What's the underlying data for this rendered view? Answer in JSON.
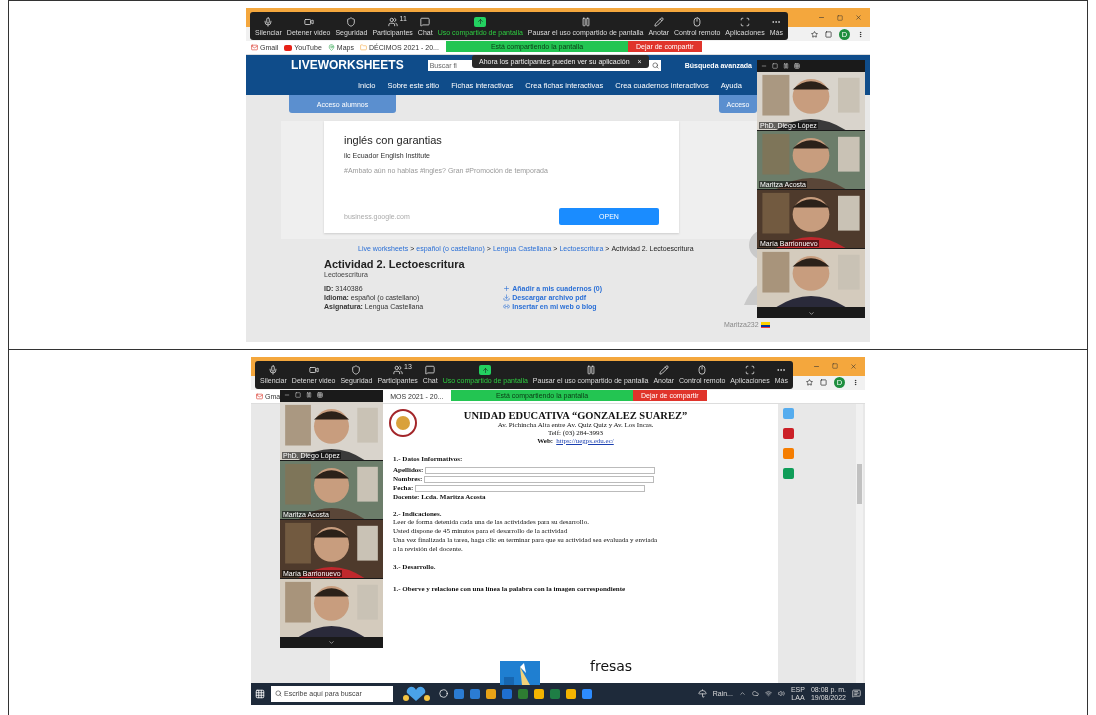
{
  "screenshots": [
    {
      "kind": "liveworksheets",
      "zoom_toolbar": {
        "buttons": [
          {
            "label": "Silenciar",
            "highlighted": false
          },
          {
            "label": "Detener video",
            "highlighted": false
          },
          {
            "label": "Seguridad",
            "highlighted": false
          },
          {
            "label": "Participantes",
            "highlighted": false,
            "count": "11"
          },
          {
            "label": "Chat",
            "highlighted": false
          },
          {
            "label": "Uso compartido de pantalla",
            "highlighted": true
          },
          {
            "label": "Pausar el uso compartido de pantalla",
            "highlighted": false
          },
          {
            "label": "Anotar",
            "highlighted": false
          },
          {
            "label": "Control remoto",
            "highlighted": false
          },
          {
            "label": "Aplicaciones",
            "highlighted": false
          },
          {
            "label": "Más",
            "highlighted": false
          }
        ],
        "sharing": "Está compartiendo la pantalla",
        "stop": "Dejar de compartir"
      },
      "profile_initial": "D",
      "bookmarks": [
        {
          "kind": "gmail",
          "label": "Gmail"
        },
        {
          "kind": "youtube",
          "label": "YouTube"
        },
        {
          "kind": "maps",
          "label": "Maps"
        },
        {
          "kind": "folder",
          "label": "DÉCIMOS 2021 - 20..."
        }
      ],
      "site": {
        "logo": "LIVEWORKSHEETS",
        "search_value": "Buscar fi",
        "advanced": "Búsqueda avanzada",
        "notification": "Ahora los participantes pueden ver su aplicación",
        "notification_close": "×",
        "nav": [
          "Inicio",
          "Sobre este sitio",
          "Fichas interactivas",
          "Crea fichas interactivas",
          "Crea cuadernos interactivos",
          "Ayuda"
        ],
        "access_tabs": [
          "Acceso alumnos",
          "Acceso"
        ],
        "ad": {
          "title": "inglés con garantias",
          "advertiser": "ilc Ecuador English Institute",
          "tags": "#Ambato aún no hablas #ingles? Gran #Promoción de temporada",
          "domain": "business.google.com",
          "button": "OPEN"
        },
        "breadcrumb": [
          {
            "label": "Live worksheets",
            "link": true
          },
          {
            "label": ">",
            "link": false
          },
          {
            "label": "español (o castellano)",
            "link": true
          },
          {
            "label": ">",
            "link": false
          },
          {
            "label": "Lengua Castellana",
            "link": true
          },
          {
            "label": ">",
            "link": false
          },
          {
            "label": "Lectoescritura",
            "link": true
          },
          {
            "label": ">",
            "link": false
          },
          {
            "label": "Actividad 2. Lectoescritura",
            "link": false
          }
        ],
        "title": "Actividad 2. Lectoescritura",
        "subtitle": "Lectoescritura",
        "meta": [
          {
            "label": "ID:",
            "value": "3140386"
          },
          {
            "label": "Idioma:",
            "value": "español (o castellano)"
          },
          {
            "label": "Asignatura:",
            "value": "Lengua Castellana"
          }
        ],
        "actions": [
          "Añadir a mis cuadernos (0)",
          "Descargar archivo pdf",
          "Insertar en mi web o blog"
        ],
        "author": "Maritza232"
      },
      "video_panel": {
        "tiles": [
          {
            "kind": "video",
            "name": "PhD. Diego López"
          },
          {
            "kind": "video",
            "name": "Maritza Acosta"
          },
          {
            "kind": "video",
            "name": "María Barrionuevo"
          },
          {
            "kind": "video"
          }
        ]
      }
    },
    {
      "kind": "document",
      "zoom_toolbar": {
        "buttons": [
          {
            "label": "Silenciar",
            "highlighted": false
          },
          {
            "label": "Detener video",
            "highlighted": false
          },
          {
            "label": "Seguridad",
            "highlighted": false
          },
          {
            "label": "Participantes",
            "highlighted": false,
            "count": "13"
          },
          {
            "label": "Chat",
            "highlighted": false
          },
          {
            "label": "Uso compartido de pantalla",
            "highlighted": true
          },
          {
            "label": "Pausar el uso compartido de pantalla",
            "highlighted": false
          },
          {
            "label": "Anotar",
            "highlighted": false
          },
          {
            "label": "Control remoto",
            "highlighted": false
          },
          {
            "label": "Aplicaciones",
            "highlighted": false
          },
          {
            "label": "Más",
            "highlighted": false
          }
        ],
        "sharing": "Está compartiendo la pantalla",
        "stop": "Dejar de compartir"
      },
      "profile_initial": "D",
      "bookmarks": [
        {
          "kind": "gmail",
          "label": "Gma"
        },
        {
          "kind": "plain",
          "label": "MOS 2021 - 20..."
        }
      ],
      "document": {
        "school": "UNIDAD EDUCATIVA “GONZALEZ SUAREZ”",
        "address": "Av. Pichincha Alta entre Av. Quiz Quiz y Av. Los Incas.",
        "phone": "Telf: (03) 284-3993",
        "web_label": "Web:",
        "web_link": "https://uegps.edu.ec/",
        "section_1": "1.- Datos Informativos:",
        "fields": [
          {
            "label": "Apellidos:"
          },
          {
            "label": "Nombres:"
          },
          {
            "label": "Fecha:"
          }
        ],
        "teacher": "Docente: Lcda. Maritza Acosta",
        "section_2": "2.- Indicaciones.",
        "instructions": [
          "Leer de forma detenida cada una de las actividades para su desarrollo.",
          "Usted dispone de 45 minutos para el desarrollo de la actividad",
          "Una vez finalizada la tarea, haga clic en terminar para que su actividad sea evaluada y enviada",
          "a la revisión del docente."
        ],
        "section_3": "3.- Desarrollo.",
        "exercise": "1.- Oberve y relacione con una línea la palabra con la imagen correspondiente",
        "word": "fresas"
      },
      "video_panel": {
        "tiles": [
          {
            "kind": "video",
            "name": "PhD. Diego López"
          },
          {
            "kind": "video",
            "name": "Maritza Acosta"
          },
          {
            "kind": "video",
            "name": "María Barrionuevo"
          },
          {
            "kind": "video"
          }
        ]
      },
      "taskbar": {
        "search_placeholder": "Escribe aquí para buscar",
        "weather": "Rain...",
        "language": "ESP",
        "layout": "LAA",
        "time": "08:08 p. m.",
        "date": "19/08/2022"
      }
    }
  ]
}
